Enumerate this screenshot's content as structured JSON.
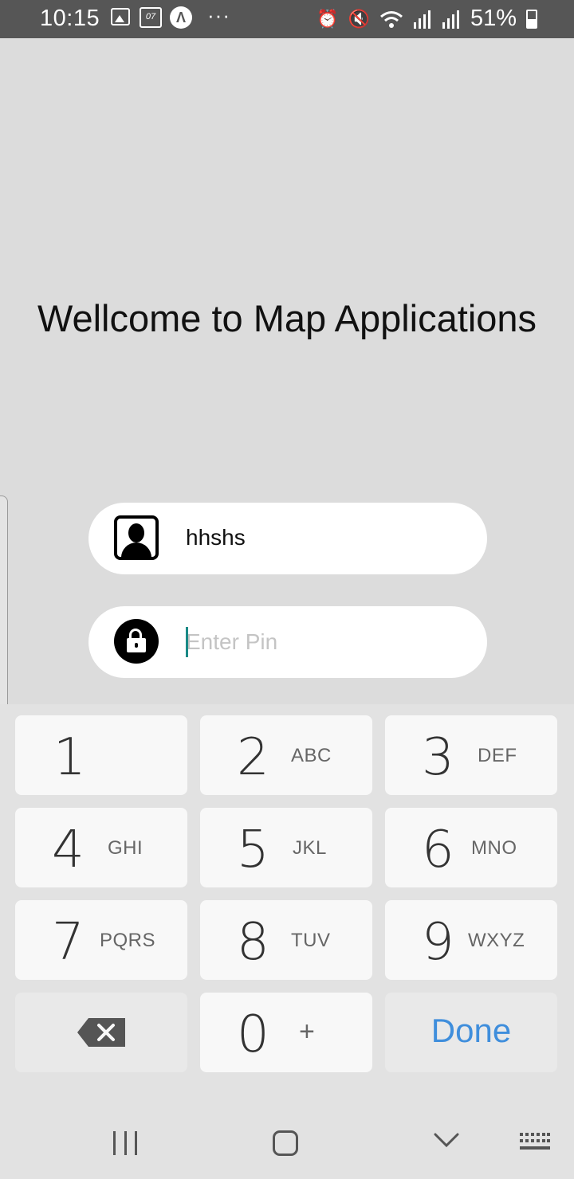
{
  "status_bar": {
    "time": "10:15",
    "calendar_day": "07",
    "a_label": "Λ",
    "more": "···",
    "battery": "51%",
    "icons": [
      "gallery-icon",
      "calendar-icon",
      "a-icon",
      "alarm-icon",
      "mute-icon",
      "wifi-icon",
      "signal-icon",
      "signal-icon",
      "battery-icon"
    ]
  },
  "title": "Wellcome to Map Applications",
  "user_field": {
    "value": "hhshs",
    "icon": "user-icon"
  },
  "pin_field": {
    "placeholder": "Enter Pin",
    "icon": "lock-open-icon"
  },
  "keypad": {
    "keys": [
      {
        "num": "1",
        "letters": ""
      },
      {
        "num": "2",
        "letters": "ABC"
      },
      {
        "num": "3",
        "letters": "DEF"
      },
      {
        "num": "4",
        "letters": "GHI"
      },
      {
        "num": "5",
        "letters": "JKL"
      },
      {
        "num": "6",
        "letters": "MNO"
      },
      {
        "num": "7",
        "letters": "PQRS"
      },
      {
        "num": "8",
        "letters": "TUV"
      },
      {
        "num": "9",
        "letters": "WXYZ"
      },
      {
        "num": "0",
        "letters": "+"
      }
    ],
    "done": "Done",
    "done_color": "#3f8edc"
  },
  "nav_bar": {
    "icons": [
      "recent-apps-icon",
      "home-icon",
      "back-chevron-icon",
      "keyboard-icon"
    ]
  }
}
